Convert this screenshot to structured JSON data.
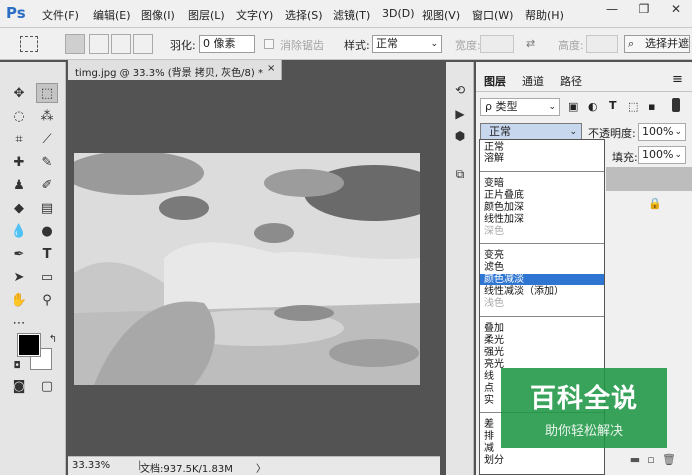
{
  "app": {
    "logo": "Ps"
  },
  "menu": [
    "文件(F)",
    "编辑(E)",
    "图像(I)",
    "图层(L)",
    "文字(Y)",
    "选择(S)",
    "滤镜(T)",
    "3D(D)",
    "视图(V)",
    "窗口(W)",
    "帮助(H)"
  ],
  "window_controls": {
    "minimize": "—",
    "restore": "❐",
    "close": "✕"
  },
  "options": {
    "feather_label": "羽化:",
    "feather_value": "0 像素",
    "antialias_label": "消除锯齿",
    "style_label": "样式:",
    "style_value": "正常",
    "width_label": "宽度:",
    "height_label": "高度:",
    "select_mask_button": "选择并遮"
  },
  "document": {
    "tab_title": "timg.jpg @ 33.3% (背景 拷贝, 灰色/8) *",
    "close": "×",
    "zoom": "33.33%",
    "doc_size": "文档:937.5K/1.83M",
    "arrow": "〉"
  },
  "layers_panel": {
    "tabs": [
      "图层",
      "通道",
      "路径"
    ],
    "kind_filter": "ρ 类型",
    "blend_mode": "正常",
    "opacity_label": "不透明度:",
    "opacity_value": "100%",
    "fill_label": "填充:",
    "fill_value": "100%"
  },
  "blend_modes": {
    "group1": [
      "正常",
      "溶解"
    ],
    "group2": [
      "变暗",
      "正片叠底",
      "颜色加深",
      "线性加深",
      "深色"
    ],
    "group3": [
      "变亮",
      "滤色",
      "颜色减淡",
      "线性减淡（添加）",
      "浅色"
    ],
    "group4": [
      "叠加",
      "柔光",
      "强光",
      "亮光",
      "线",
      "点",
      "实"
    ],
    "group5": [
      "差",
      "排",
      "减",
      "划分"
    ],
    "disabled": [
      "深色",
      "浅色"
    ],
    "selected": "颜色减淡"
  },
  "watermark": {
    "title": "百科全说",
    "subtitle": "助你轻松解决"
  },
  "colors": {
    "accent": "#2f76d2",
    "watermark_green": "#1e9646"
  }
}
